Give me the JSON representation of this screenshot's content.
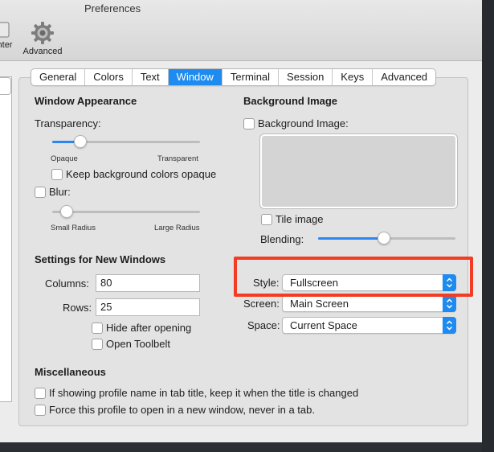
{
  "window": {
    "title": "Preferences"
  },
  "toolbar": {
    "items": [
      {
        "label": "nter",
        "icon": "partial-toolbar-icon"
      },
      {
        "label": "Advanced",
        "icon": "gear-icon"
      }
    ]
  },
  "tabs": [
    "General",
    "Colors",
    "Text",
    "Window",
    "Terminal",
    "Session",
    "Keys",
    "Advanced"
  ],
  "active_tab": "Window",
  "window_appearance": {
    "heading": "Window Appearance",
    "transparency_label": "Transparency:",
    "transparency_min": "Opaque",
    "transparency_max": "Transparent",
    "transparency_value": 0.19,
    "keep_bg_opaque": {
      "label": "Keep background colors opaque",
      "checked": false
    },
    "blur": {
      "label": "Blur:",
      "checked": false
    },
    "blur_min": "Small Radius",
    "blur_max": "Large Radius",
    "blur_value": 0.1
  },
  "new_windows": {
    "heading": "Settings for New Windows",
    "columns_label": "Columns:",
    "columns_value": "80",
    "rows_label": "Rows:",
    "rows_value": "25",
    "hide_after_opening": {
      "label": "Hide after opening",
      "checked": false
    },
    "open_toolbelt": {
      "label": "Open Toolbelt",
      "checked": false
    }
  },
  "background_image": {
    "heading": "Background Image",
    "checkbox_label": "Background Image:",
    "tile_image_label": "Tile image",
    "blending_label": "Blending:",
    "blending_value": 0.48
  },
  "style": {
    "label": "Style:",
    "value": "Fullscreen"
  },
  "screen": {
    "label": "Screen:",
    "value": "Main Screen"
  },
  "space": {
    "label": "Space:",
    "value": "Current Space"
  },
  "misc": {
    "heading": "Miscellaneous",
    "keep_profile_name": "If showing profile name in tab title, keep it when the title is changed",
    "force_new_window": "Force this profile to open in a new window, never in a tab."
  },
  "colors": {
    "accent": "#1e8bf0",
    "highlight": "#f23c24"
  }
}
